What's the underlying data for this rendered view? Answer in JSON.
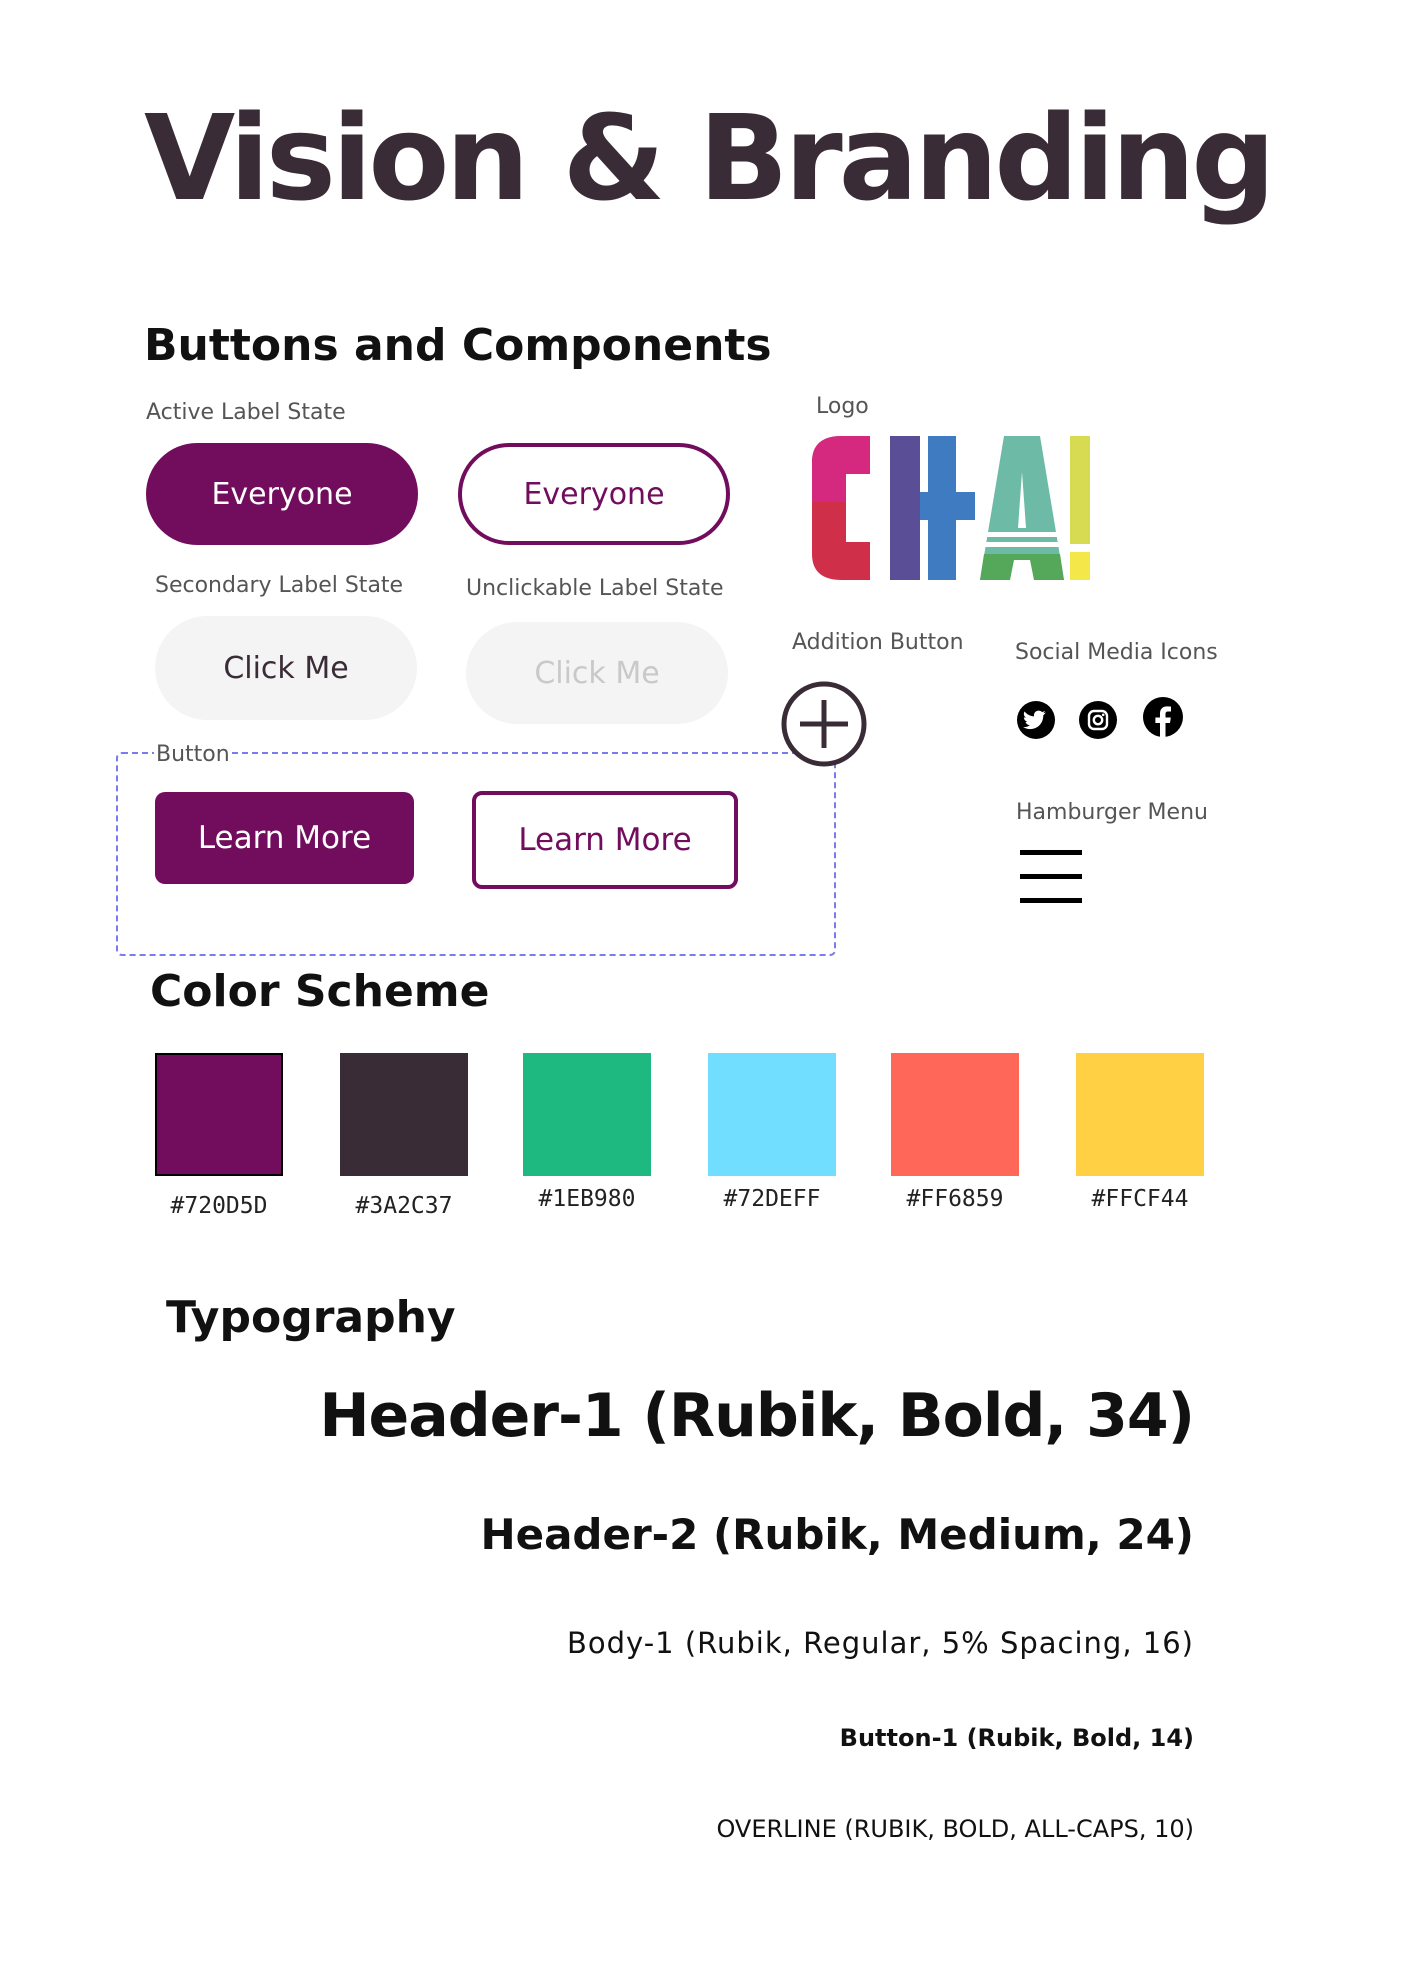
{
  "page_title": "Vision & Branding",
  "buttons_section": {
    "title": "Buttons and Components",
    "active_label_caption": "Active Label State",
    "active_label_text": "Everyone",
    "active_outline_text": "Everyone",
    "secondary_label_caption": "Secondary Label State",
    "secondary_label_text": "Click Me",
    "unclickable_label_caption": "Unclickable Label State",
    "unclickable_label_text": "Click Me",
    "button_caption": "Button",
    "learn_more_filled": "Learn More",
    "learn_more_outline": "Learn More"
  },
  "logo": {
    "caption": "Logo",
    "letters": [
      {
        "char": "C",
        "color": "#D02F4A",
        "accent": "#D4297F"
      },
      {
        "char": "H",
        "color": "#5A4E97",
        "accent": "#3F7BC1"
      },
      {
        "char": "A",
        "color": "#6DBBA6",
        "accent": "#55A85A"
      },
      {
        "char": "!",
        "color": "#D6DB52",
        "accent": "#F4E74A"
      }
    ]
  },
  "addition_button": {
    "caption": "Addition Button",
    "icon": "plus-circle-icon"
  },
  "social_media": {
    "caption": "Social Media Icons",
    "icons": [
      "twitter-icon",
      "instagram-icon",
      "facebook-icon"
    ]
  },
  "hamburger": {
    "caption": "Hamburger Menu",
    "icon": "hamburger-icon"
  },
  "color_scheme": {
    "title": "Color Scheme",
    "swatches": [
      {
        "hex": "#720D5D",
        "label": "#720D5D"
      },
      {
        "hex": "#3A2C37",
        "label": "#3A2C37"
      },
      {
        "hex": "#1EB980",
        "label": "#1EB980"
      },
      {
        "hex": "#72DEFF",
        "label": "#72DEFF"
      },
      {
        "hex": "#FF6859",
        "label": "#FF6859"
      },
      {
        "hex": "#FFCF44",
        "label": "#FFCF44"
      }
    ]
  },
  "typography": {
    "title": "Typography",
    "header1": "Header-1 (Rubik, Bold, 34)",
    "header2": "Header-2 (Rubik, Medium, 24)",
    "body1": "Body-1 (Rubik, Regular, 5% Spacing, 16)",
    "button1": "Button-1 (Rubik, Bold, 14)",
    "overline": "OVERLINE (RUBIK, BOLD, ALL-CAPS, 10)"
  },
  "colors": {
    "brand_purple": "#720D5D",
    "brand_dark": "#3A2C37",
    "disabled_bg": "#F4F4F4",
    "disabled_text": "#C9C9C9",
    "dashed_border": "#7B7BF0"
  }
}
